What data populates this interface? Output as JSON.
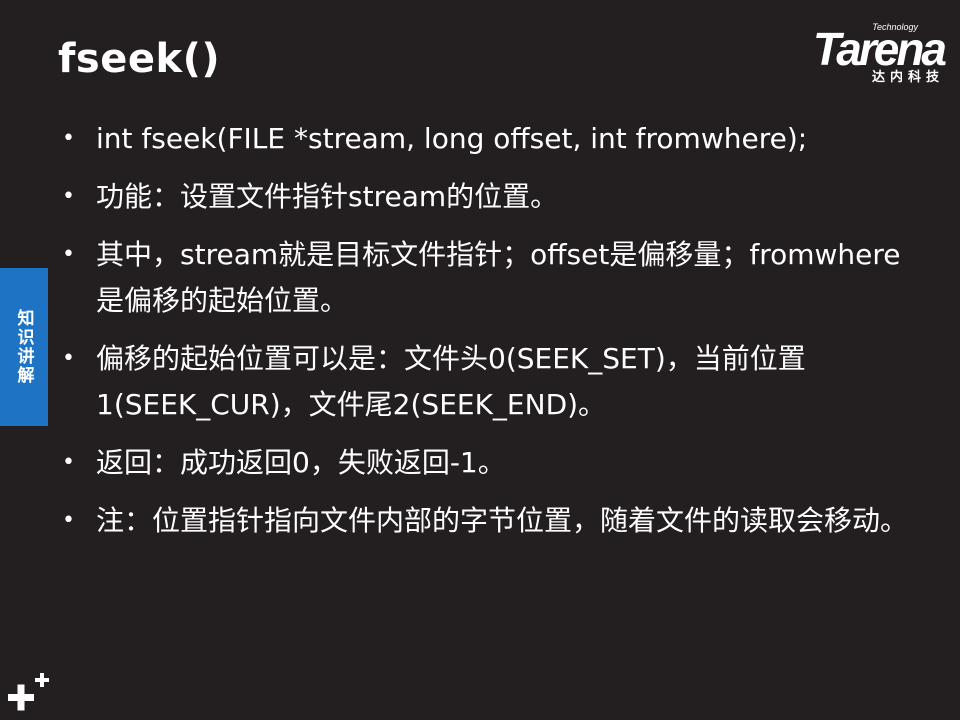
{
  "slide": {
    "title": "fseek()"
  },
  "logo": {
    "small_text": "Technology",
    "brand": "Tarena",
    "subtitle_cn": "达内科技"
  },
  "side_tab": {
    "label": "知识讲解"
  },
  "bullets": [
    "int fseek(FILE *stream, long offset, int fromwhere);",
    "功能：设置文件指针stream的位置。",
    "其中，stream就是目标文件指针；offset是偏移量；fromwhere是偏移的起始位置。",
    "偏移的起始位置可以是：文件头0(SEEK_SET)，当前位置1(SEEK_CUR)，文件尾2(SEEK_END)。",
    "返回：成功返回0，失败返回-1。",
    "注：位置指针指向文件内部的字节位置，随着文件的读取会移动。"
  ],
  "colors": {
    "background": "#231f20",
    "text": "#ffffff",
    "side_tab": "#1e73c5"
  }
}
